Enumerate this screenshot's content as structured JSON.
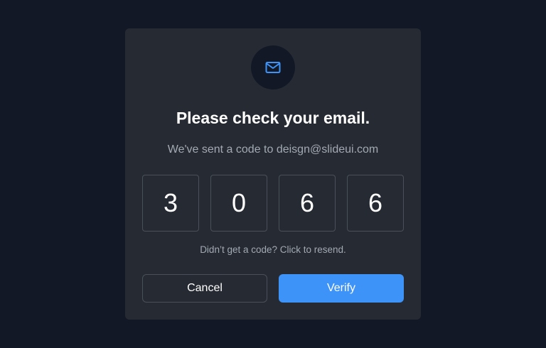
{
  "modal": {
    "icon": "mail-icon",
    "title": "Please check your email.",
    "subtitle": "We've sent a code to deisgn@slideui.com",
    "code_digits": [
      "3",
      "0",
      "6",
      "6"
    ],
    "resend_text": "Didn’t get a code? Click to resend.",
    "cancel_label": "Cancel",
    "verify_label": "Verify"
  },
  "colors": {
    "background": "#121826",
    "card": "#262b33",
    "accent": "#3d93f8",
    "muted_text": "#a3a9b3",
    "border": "#4a5059"
  }
}
